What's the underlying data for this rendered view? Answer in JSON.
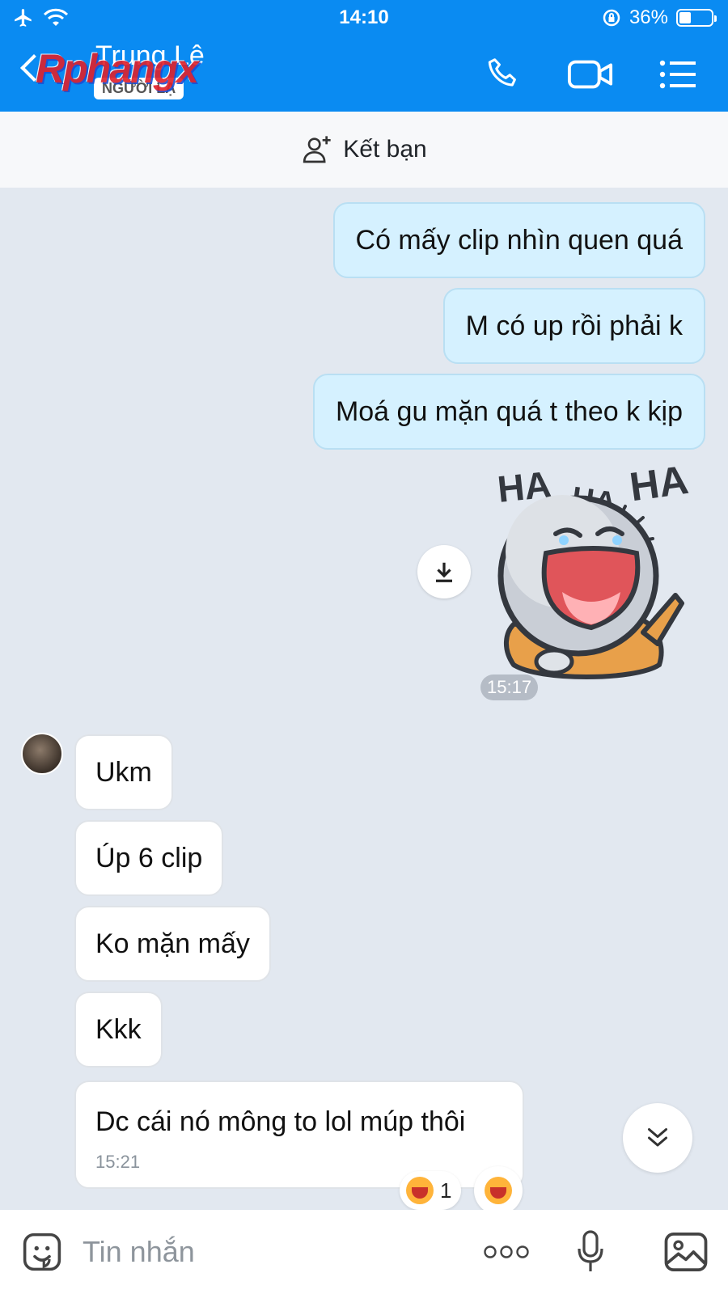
{
  "status_bar": {
    "time": "14:10",
    "battery": "36%",
    "battery_level": 0.36
  },
  "header": {
    "contact_name": "Trung Lê",
    "badge": "NGƯỜI LẠ",
    "watermark": "Rphangx",
    "icons": [
      "back-icon",
      "phone-icon",
      "video-call-icon",
      "menu-list-icon"
    ]
  },
  "friend_bar": {
    "label": "Kết bạn",
    "icon": "add-friend-icon"
  },
  "messages_out": [
    "Có mấy clip nhìn quen quá",
    "M có up rồi phải k",
    "Moá gu mặn quá t theo k kịp"
  ],
  "sticker": {
    "text_1": "HA",
    "text_2": "HA",
    "text_3": "HA",
    "icon": "laughing-sticker"
  },
  "sticker_time": "15:17",
  "messages_in": [
    "Ukm",
    "Úp 6 clip",
    "Ko mặn mấy",
    "Kkk"
  ],
  "last_message": {
    "text": "Dc cái nó mông to lol múp thôi",
    "time": "15:21"
  },
  "reaction": {
    "count": "1",
    "icon": "laughing-emoji-icon"
  },
  "input_bar": {
    "placeholder": "Tin nhắn",
    "icons": [
      "sticker-icon",
      "more-icon",
      "microphone-icon",
      "image-icon"
    ]
  },
  "colors": {
    "header": "#0a8bf2",
    "bubble_out": "#d5f1ff",
    "background": "#e2e8f0"
  }
}
